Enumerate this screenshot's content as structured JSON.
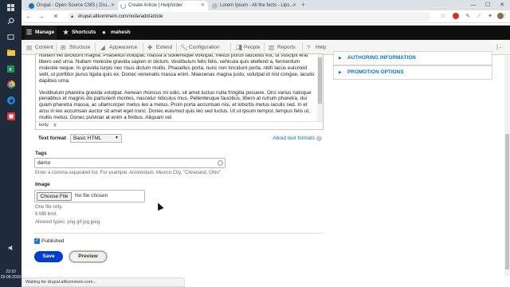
{
  "taskbar": {
    "icons": [
      "windows-icon",
      "search-icon",
      "task-view-icon",
      "file-explorer-icon",
      "spreadsheet-icon",
      "chrome-icon",
      "edge-icon",
      "app-icon"
    ],
    "time": "23:10",
    "date": "29-08-2020"
  },
  "browser": {
    "tabs": [
      {
        "title": "Drupal - Open Source CMS | Dru...",
        "active": false
      },
      {
        "title": "Create Article | Helpfolder",
        "active": true
      },
      {
        "title": "Lorem Ipsum - All the facts - Lips...",
        "active": false
      }
    ],
    "url": "drupal.altkommein.com/node/add/article",
    "status": "Waiting for drupal.altkommein.com..."
  },
  "toolbar": {
    "manage": "Manage",
    "shortcuts": "Shortcuts",
    "user": "mahesh"
  },
  "admin_menu": [
    {
      "label": "Content",
      "icon": "content-icon"
    },
    {
      "label": "Structure",
      "icon": "structure-icon"
    },
    {
      "label": "Appearance",
      "icon": "appearance-icon"
    },
    {
      "label": "Extend",
      "icon": "extend-icon"
    },
    {
      "label": "Configuration",
      "icon": "configuration-icon"
    },
    {
      "label": "People",
      "icon": "people-icon"
    },
    {
      "label": "Reports",
      "icon": "reports-icon"
    },
    {
      "label": "Help",
      "icon": "help-icon"
    }
  ],
  "editor": {
    "paragraphs": [
      "Nullam vel tincidunt magna. Phasellus volutpat, massa a scelerisque volutpat, metus purus faucibus est, ut suscipit erat libero sed urna. Nullam molestie gravida sapien in dictum. Vestibulum felis felis, vehicula quis eleifend a, fermentum molestie neque. In gravida turpis nec risus dictum mollis. Phasellus porta, nunc non tincidunt porta, nibh lacus euismod velit, ut porttitor purus ligula quis ex. Donec venenatis massa enim. Maecenas magna justo, volutpat id nisl congue, iaculis dapibus urna.",
      "Vestibulum pharetra gravida volutpat. Aenean rhoncus mi odio, sit amet luctus nulla fringilla posuere. Orci varius natoque penatibus et magnis dis parturient montes, nascetur ridiculus mus. Pellentesque faucibus, libero at rutrum pharetra, dui quam pharetra massa, ac ullamcorper metus leo a metus. Proin porta accumsan nisi, et lobortis metus iaculis sed. In et arcu in leo accumsan auctor sit amet eget nunc. Donec euismod quis leo sed luctus. Ut ut ipsum tempor, tempus felis ut, mollis metus. Donec pulvinar at enim a finibus. Aliquam vel"
    ],
    "path": [
      "body",
      "p"
    ]
  },
  "text_format": {
    "label": "Text format",
    "value": "Basic HTML",
    "about": "About text formats"
  },
  "tags": {
    "label": "Tags",
    "value": "demo",
    "help": "Enter a comma-separated list. For example: Amsterdam, Mexico City, \"Cleveland, Ohio\""
  },
  "image": {
    "label": "Image",
    "button": "Choose File",
    "no_file": "No file chosen",
    "help_lines": [
      "One file only.",
      "8 MB limit.",
      "Allowed types: png gif jpg jpeg."
    ]
  },
  "published": {
    "label": "Published",
    "checked": true
  },
  "actions": {
    "save": "Save",
    "preview": "Preview"
  },
  "sidebar": {
    "sections": [
      "AUTHORING INFORMATION",
      "PROMOTION OPTIONS"
    ]
  },
  "colors": {
    "link": "#0074bd",
    "primary_button": "#003ecc",
    "toolbar_bg": "#0f0f0f"
  }
}
